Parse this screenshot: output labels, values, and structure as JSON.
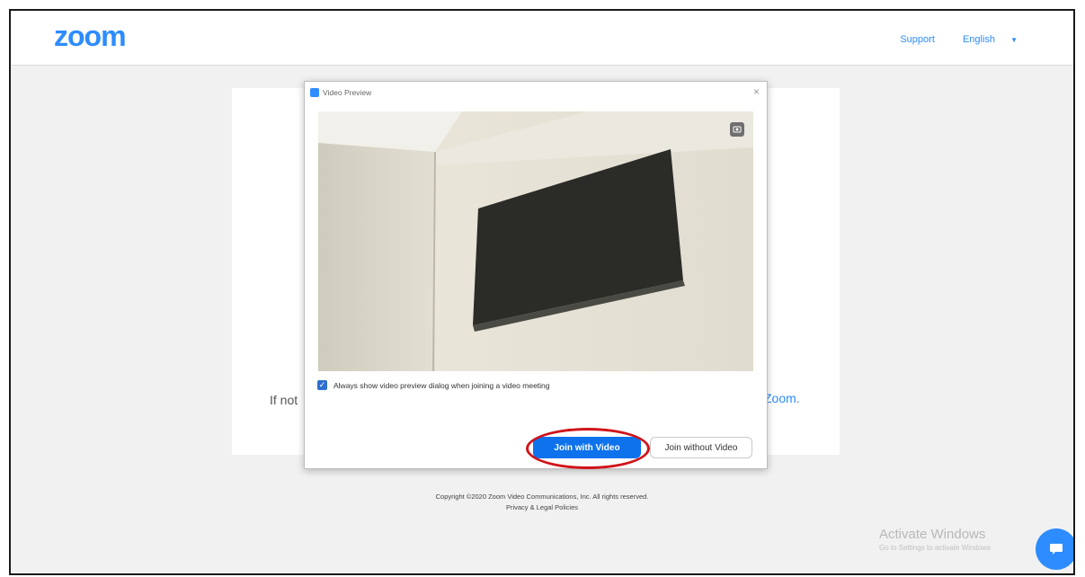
{
  "header": {
    "logo": "zoom",
    "links": [
      "Support",
      "English"
    ]
  },
  "background": {
    "prompt_fragment": "If not",
    "link_fragment": "Zoom."
  },
  "footer": {
    "copyright": "Copyright ©2020 Zoom Video Communications, Inc. All rights reserved.",
    "legal": "Privacy & Legal Policies"
  },
  "watermark": {
    "title": "Activate Windows",
    "subtitle": "Go to Settings to activate Windows"
  },
  "dialog": {
    "title": "Video Preview",
    "close": "×",
    "checkbox_label": "Always show video preview dialog when joining a video meeting",
    "checkbox_checked": true,
    "join_video_label": "Join with Video",
    "join_no_video_label": "Join without Video",
    "accent_color": "#0e72ed"
  }
}
